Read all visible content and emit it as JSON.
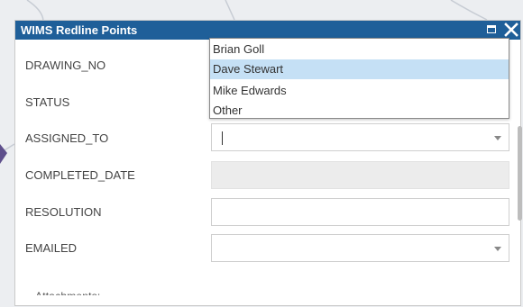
{
  "window": {
    "title": "WIMS Redline Points"
  },
  "form": {
    "fields": [
      {
        "label": "DRAWING_NO"
      },
      {
        "label": "STATUS"
      },
      {
        "label": "ASSIGNED_TO",
        "value": ""
      },
      {
        "label": "COMPLETED_DATE",
        "value": ""
      },
      {
        "label": "RESOLUTION",
        "value": ""
      },
      {
        "label": "EMAILED",
        "value": ""
      }
    ],
    "attachments_label": "Attachments:"
  },
  "assigned_to_dropdown": {
    "options": [
      "Brian Goll",
      "Dave Stewart",
      "Mike Edwards",
      "Other"
    ],
    "highlighted": "Dave Stewart"
  },
  "colors": {
    "titlebar": "#1f5f99",
    "highlight": "#c5e0f5"
  },
  "icons": [
    "maximize-icon",
    "close-icon",
    "chevron-down-icon"
  ]
}
